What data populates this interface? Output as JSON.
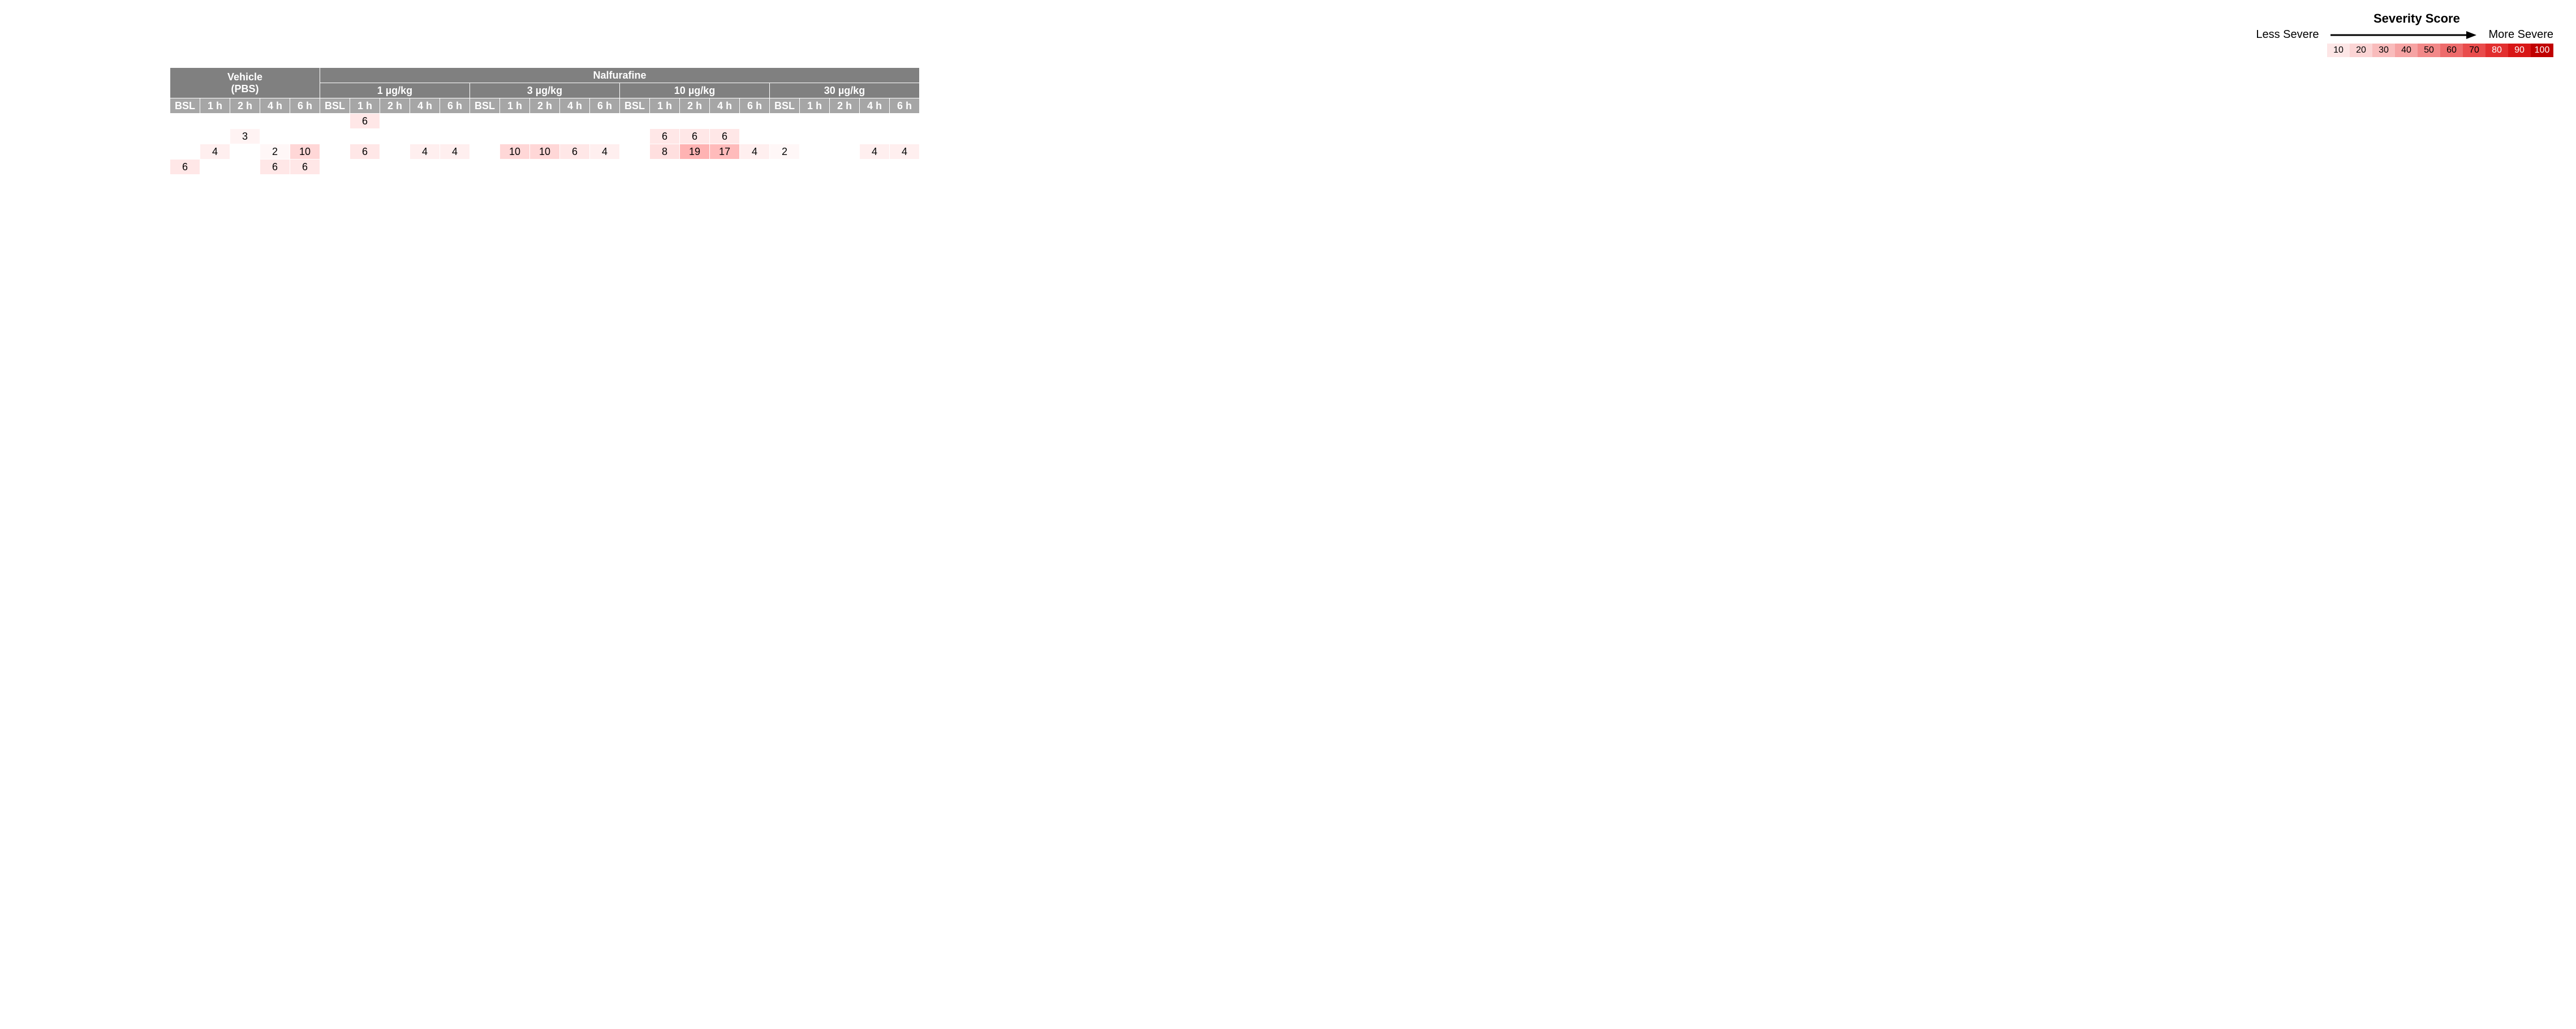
{
  "legend": {
    "title": "Severity Score",
    "less": "Less Severe",
    "more": "More Severe",
    "scale": [
      10,
      20,
      30,
      40,
      50,
      60,
      70,
      80,
      90,
      100
    ],
    "colors": [
      "#fde6e6",
      "#fbd4d4",
      "#f9bcbc",
      "#f6a3a3",
      "#f28888",
      "#ee6b6b",
      "#e94c4c",
      "#e22f2f",
      "#d81616",
      "#c00000"
    ]
  },
  "groups": [
    {
      "label_top": "Vehicle",
      "label_bottom": "(PBS)",
      "dose": null
    },
    {
      "label_top": "Nalfurafine",
      "label_bottom": null,
      "dose": null
    }
  ],
  "doses": [
    "1 µg/kg",
    "3 µg/kg",
    "10 µg/kg",
    "30 µg/kg"
  ],
  "timepoints": [
    "BSL",
    "1 h",
    "2 h",
    "4 h",
    "6 h"
  ],
  "chart_data": {
    "type": "heatmap",
    "title": "Severity Score",
    "x_groups": [
      {
        "group": "Vehicle (PBS)",
        "times": [
          "BSL",
          "1 h",
          "2 h",
          "4 h",
          "6 h"
        ]
      },
      {
        "group": "Nalfurafine 1 µg/kg",
        "times": [
          "BSL",
          "1 h",
          "2 h",
          "4 h",
          "6 h"
        ]
      },
      {
        "group": "Nalfurafine 3 µg/kg",
        "times": [
          "BSL",
          "1 h",
          "2 h",
          "4 h",
          "6 h"
        ]
      },
      {
        "group": "Nalfurafine 10 µg/kg",
        "times": [
          "BSL",
          "1 h",
          "2 h",
          "4 h",
          "6 h"
        ]
      },
      {
        "group": "Nalfurafine 30 µg/kg",
        "times": [
          "BSL",
          "1 h",
          "2 h",
          "4 h",
          "6 h"
        ]
      }
    ],
    "rows": [
      {
        "label": "row1",
        "values": [
          null,
          null,
          null,
          null,
          null,
          null,
          6,
          null,
          null,
          null,
          null,
          null,
          null,
          null,
          null,
          null,
          null,
          null,
          null,
          null,
          null,
          null,
          null,
          null,
          null
        ]
      },
      {
        "label": "row2",
        "values": [
          null,
          null,
          3,
          null,
          null,
          null,
          null,
          null,
          null,
          null,
          null,
          null,
          null,
          null,
          null,
          null,
          6,
          6,
          6,
          null,
          null,
          null,
          null,
          null,
          null
        ]
      },
      {
        "label": "row3",
        "values": [
          null,
          4,
          null,
          2,
          10,
          null,
          6,
          null,
          4,
          4,
          null,
          10,
          10,
          6,
          4,
          null,
          8,
          19,
          17,
          4,
          2,
          null,
          null,
          4,
          4
        ]
      },
      {
        "label": "row4",
        "values": [
          6,
          null,
          null,
          6,
          6,
          null,
          null,
          null,
          null,
          null,
          null,
          null,
          null,
          null,
          null,
          null,
          null,
          null,
          null,
          null,
          null,
          null,
          null,
          null,
          null
        ]
      }
    ],
    "color_scale_domain": [
      0,
      100
    ],
    "legend_values": [
      10,
      20,
      30,
      40,
      50,
      60,
      70,
      80,
      90,
      100
    ]
  }
}
